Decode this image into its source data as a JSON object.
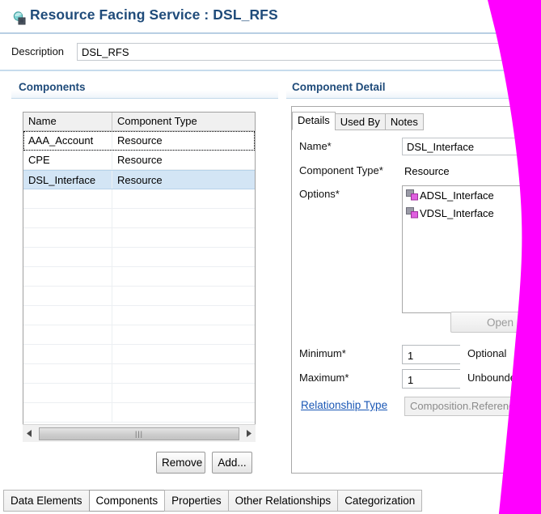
{
  "window": {
    "title": "Resource Facing Service : DSL_RFS",
    "title_icon": "service-component-icon",
    "title_color": "#1f4b7a"
  },
  "description": {
    "label": "Description",
    "value": "DSL_RFS",
    "placeholder": ""
  },
  "components_section": {
    "title": "Components",
    "table": {
      "columns": [
        "Name",
        "Component Type"
      ],
      "rows": [
        {
          "name": "AAA_Account",
          "type": "Resource",
          "state": "focused"
        },
        {
          "name": "CPE",
          "type": "Resource",
          "state": "normal"
        },
        {
          "name": "DSL_Interface",
          "type": "Resource",
          "state": "selected"
        }
      ],
      "empty_row_count": 11
    },
    "scrollbar": {
      "left_arrow": "◀",
      "right_arrow": "▶",
      "grip": "|||"
    },
    "buttons": {
      "remove": "Remove",
      "add": "Add..."
    }
  },
  "component_detail": {
    "title": "Component Detail",
    "tabs": [
      {
        "label": "Details",
        "active": true
      },
      {
        "label": "Used By",
        "active": false
      },
      {
        "label": "Notes",
        "active": false
      }
    ],
    "fields": {
      "name_label": "Name*",
      "name_value": "DSL_Interface",
      "component_type_label": "Component Type*",
      "component_type_value": "Resource",
      "options_label": "Options*",
      "options": [
        {
          "label": "ADSL_Interface",
          "icon": "component-option-icon"
        },
        {
          "label": "VDSL_Interface",
          "icon": "component-option-icon"
        }
      ],
      "open_button": "Open",
      "open_button_enabled": false,
      "minimum_label": "Minimum*",
      "minimum_value": "1",
      "minimum_caption": "Optional",
      "maximum_label": "Maximum*",
      "maximum_value": "1",
      "maximum_caption": "Unbounded",
      "relationship_type_link": "Relationship Type",
      "relationship_type_value": "Composition.Reference",
      "spin_up_glyph": "▲",
      "spin_dn_glyph": "▼"
    }
  },
  "bottom_tabs": [
    {
      "label": "Data Elements",
      "active": false
    },
    {
      "label": "Components",
      "active": true
    },
    {
      "label": "Properties",
      "active": false
    },
    {
      "label": "Other Relationships",
      "active": false
    },
    {
      "label": "Categorization",
      "active": false
    }
  ],
  "colors": {
    "accent": "#1f4b7a",
    "selection": "#d3e5f5",
    "link": "#1a57b5",
    "mask": "#FF00FF",
    "option_icon_primary": "#8f8f9c",
    "option_icon_secondary": "#d94fd9"
  }
}
